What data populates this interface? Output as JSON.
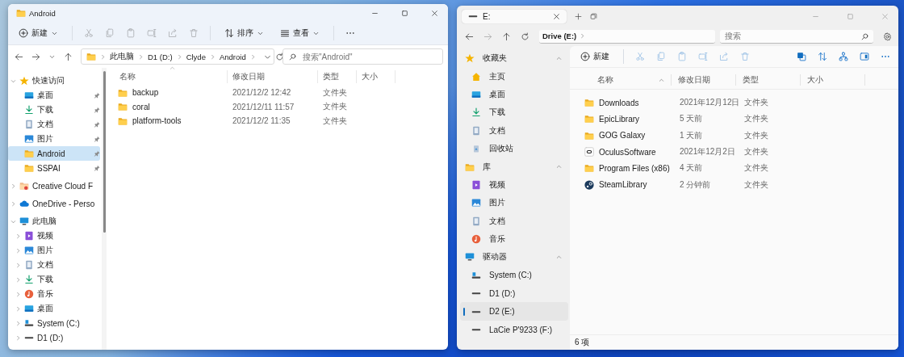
{
  "left_window": {
    "title": "Android",
    "toolbar": [
      {
        "kind": "new",
        "label": "新建",
        "menu": true,
        "disabled": false
      },
      {
        "kind": "cut",
        "disabled": true
      },
      {
        "kind": "copy",
        "disabled": true
      },
      {
        "kind": "paste",
        "disabled": true
      },
      {
        "kind": "rename",
        "disabled": true
      },
      {
        "kind": "share",
        "disabled": true
      },
      {
        "kind": "delete",
        "disabled": true
      },
      {
        "kind": "sort",
        "label": "排序",
        "menu": true,
        "disabled": false
      },
      {
        "kind": "view",
        "label": "查看",
        "menu": true,
        "disabled": false
      },
      {
        "kind": "more",
        "disabled": false
      }
    ],
    "breadcrumb": [
      "此电脑",
      "D1 (D:)",
      "Clyde",
      "Android"
    ],
    "search": {
      "placeholder": "搜索\"Android\""
    },
    "sidebar": [
      {
        "label": "快速访问",
        "kind": "star",
        "expanded": true,
        "selected": false,
        "children": [
          {
            "label": "桌面",
            "kind": "desktop",
            "pinned": true,
            "selected": false
          },
          {
            "label": "下载",
            "kind": "download",
            "pinned": true,
            "selected": false
          },
          {
            "label": "文档",
            "kind": "document",
            "pinned": true,
            "selected": false
          },
          {
            "label": "图片",
            "kind": "picture",
            "pinned": true,
            "selected": false
          },
          {
            "label": "Android",
            "kind": "folder",
            "pinned": true,
            "selected": true
          },
          {
            "label": "SSPAI",
            "kind": "folder",
            "pinned": true,
            "selected": false
          }
        ]
      },
      {
        "label": "Creative Cloud F",
        "kind": "cloud-folder",
        "expanded": false,
        "selected": false
      },
      {
        "label": "OneDrive - Perso",
        "kind": "cloud",
        "expanded": false,
        "selected": false
      },
      {
        "label": "此电脑",
        "kind": "pc",
        "expanded": true,
        "selected": false,
        "children": [
          {
            "label": "视频",
            "kind": "video",
            "expanded": false,
            "selected": false
          },
          {
            "label": "图片",
            "kind": "picture",
            "expanded": false,
            "selected": false
          },
          {
            "label": "文档",
            "kind": "document",
            "expanded": false,
            "selected": false
          },
          {
            "label": "下载",
            "kind": "download",
            "expanded": false,
            "selected": false
          },
          {
            "label": "音乐",
            "kind": "music",
            "expanded": false,
            "selected": false
          },
          {
            "label": "桌面",
            "kind": "desktop",
            "expanded": false,
            "selected": false
          },
          {
            "label": "System (C:)",
            "kind": "system-drive",
            "expanded": false,
            "selected": false
          },
          {
            "label": "D1 (D:)",
            "kind": "drive",
            "expanded": false,
            "selected": false
          }
        ]
      }
    ],
    "columns": [
      {
        "label": "名称",
        "sorted": true
      },
      {
        "label": "修改日期",
        "sorted": false
      },
      {
        "label": "类型",
        "sorted": false
      },
      {
        "label": "大小",
        "sorted": false
      }
    ],
    "rows": [
      {
        "kind": "folder",
        "name": "backup",
        "modified": "2021/12/2 12:42",
        "type": "文件夹"
      },
      {
        "kind": "folder",
        "name": "coral",
        "modified": "2021/12/11 11:57",
        "type": "文件夹"
      },
      {
        "kind": "folder",
        "name": "platform-tools",
        "modified": "2021/12/2 11:35",
        "type": "文件夹"
      }
    ]
  },
  "right_window": {
    "tabs": [
      {
        "label": "E:",
        "selected": true
      }
    ],
    "breadcrumb": [
      "Drive (E:)"
    ],
    "search": {
      "placeholder": "搜索"
    },
    "sidebar": [
      {
        "label": "收藏夹",
        "kind": "star",
        "expanded": true,
        "items": [
          {
            "label": "主页",
            "kind": "home",
            "selected": false
          },
          {
            "label": "桌面",
            "kind": "desktop",
            "selected": false
          },
          {
            "label": "下载",
            "kind": "download",
            "selected": false
          },
          {
            "label": "文档",
            "kind": "document",
            "selected": false
          },
          {
            "label": "回收站",
            "kind": "recycle",
            "selected": false
          }
        ]
      },
      {
        "label": "库",
        "kind": "folder",
        "expanded": true,
        "items": [
          {
            "label": "视频",
            "kind": "video",
            "selected": false
          },
          {
            "label": "图片",
            "kind": "picture",
            "selected": false
          },
          {
            "label": "文档",
            "kind": "document",
            "selected": false
          },
          {
            "label": "音乐",
            "kind": "music",
            "selected": false
          }
        ]
      },
      {
        "label": "驱动器",
        "kind": "pc",
        "expanded": true,
        "items": [
          {
            "label": "System (C:)",
            "kind": "system-drive",
            "selected": false
          },
          {
            "label": "D1 (D:)",
            "kind": "drive",
            "selected": false
          },
          {
            "label": "D2 (E:)",
            "kind": "drive",
            "selected": true
          },
          {
            "label": "LaCie P'9233 (F:)",
            "kind": "drive",
            "selected": false
          }
        ]
      }
    ],
    "toolbar": [
      {
        "kind": "new",
        "label": "新建",
        "menu": false,
        "disabled": false
      },
      {
        "kind": "cut",
        "disabled": true
      },
      {
        "kind": "copy",
        "disabled": true
      },
      {
        "kind": "paste",
        "disabled": true
      },
      {
        "kind": "rename",
        "disabled": true
      },
      {
        "kind": "share",
        "disabled": true
      },
      {
        "kind": "delete",
        "disabled": true
      }
    ],
    "toolbar_right": [
      {
        "kind": "select"
      },
      {
        "kind": "sort"
      },
      {
        "kind": "group"
      },
      {
        "kind": "pane"
      },
      {
        "kind": "more"
      }
    ],
    "columns": [
      {
        "label": "名称",
        "sorted": true
      },
      {
        "label": "修改日期",
        "sorted": false
      },
      {
        "label": "类型",
        "sorted": false
      },
      {
        "label": "大小",
        "sorted": false
      }
    ],
    "rows": [
      {
        "kind": "folder",
        "name": "Downloads",
        "modified": "2021年12月12日",
        "type": "文件夹"
      },
      {
        "kind": "folder",
        "name": "EpicLibrary",
        "modified": "5 天前",
        "type": "文件夹"
      },
      {
        "kind": "folder",
        "name": "GOG Galaxy",
        "modified": "1 天前",
        "type": "文件夹"
      },
      {
        "kind": "app",
        "name": "OculusSoftware",
        "modified": "2021年12月2日",
        "type": "文件夹"
      },
      {
        "kind": "folder",
        "name": "Program Files (x86)",
        "modified": "4 天前",
        "type": "文件夹"
      },
      {
        "kind": "steam",
        "name": "SteamLibrary",
        "modified": "2 分钟前",
        "type": "文件夹"
      }
    ],
    "status": "6 项"
  }
}
